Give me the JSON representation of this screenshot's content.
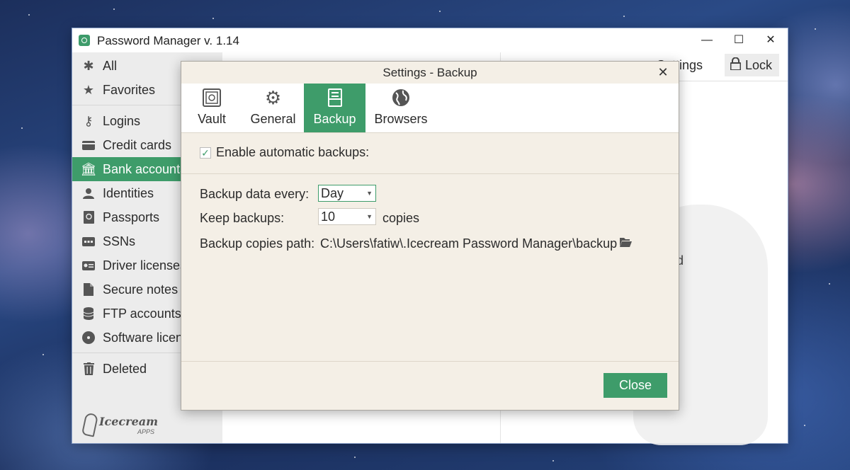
{
  "window": {
    "title": "Password Manager v. 1.14",
    "minimize": "—",
    "maximize": "☐",
    "close": "✕"
  },
  "sidebar": {
    "items": [
      {
        "label": "All",
        "icon": "asterisk-icon"
      },
      {
        "label": "Favorites",
        "icon": "star-icon"
      },
      {
        "label": "Logins",
        "icon": "key-icon"
      },
      {
        "label": "Credit cards",
        "icon": "credit-card-icon"
      },
      {
        "label": "Bank accounts",
        "icon": "bank-icon",
        "active": true
      },
      {
        "label": "Identities",
        "icon": "person-icon"
      },
      {
        "label": "Passports",
        "icon": "passport-icon"
      },
      {
        "label": "SSNs",
        "icon": "ssn-card-icon"
      },
      {
        "label": "Driver licenses",
        "icon": "id-card-icon"
      },
      {
        "label": "Secure notes",
        "icon": "note-icon"
      },
      {
        "label": "FTP accounts",
        "icon": "database-icon"
      },
      {
        "label": "Software licen",
        "icon": "disc-icon"
      },
      {
        "label": "Deleted",
        "icon": "trash-icon"
      }
    ],
    "logo_text": "Icecream",
    "logo_sub": "APPS"
  },
  "toolbar": {
    "settings_label": "Settings",
    "lock_label": "Lock"
  },
  "background_text": "ted",
  "dialog": {
    "title": "Settings - Backup",
    "close": "✕",
    "tabs": [
      {
        "label": "Vault",
        "icon": "vault-icon"
      },
      {
        "label": "General",
        "icon": "gear-icon"
      },
      {
        "label": "Backup",
        "icon": "backup-icon",
        "active": true
      },
      {
        "label": "Browsers",
        "icon": "globe-icon"
      }
    ],
    "enable_backups_label": "Enable automatic backups:",
    "enable_backups_checked": true,
    "backup_every_label": "Backup data every:",
    "backup_every_value": "Day",
    "keep_backups_label": "Keep backups:",
    "keep_backups_value": "10",
    "copies_label": "copies",
    "path_label": "Backup copies path:",
    "path_value": "C:\\Users\\fatiw\\.Icecream Password Manager\\backup",
    "close_button": "Close"
  },
  "colors": {
    "accent": "#3e9c6a",
    "dialog_bg": "#f4efe6"
  }
}
